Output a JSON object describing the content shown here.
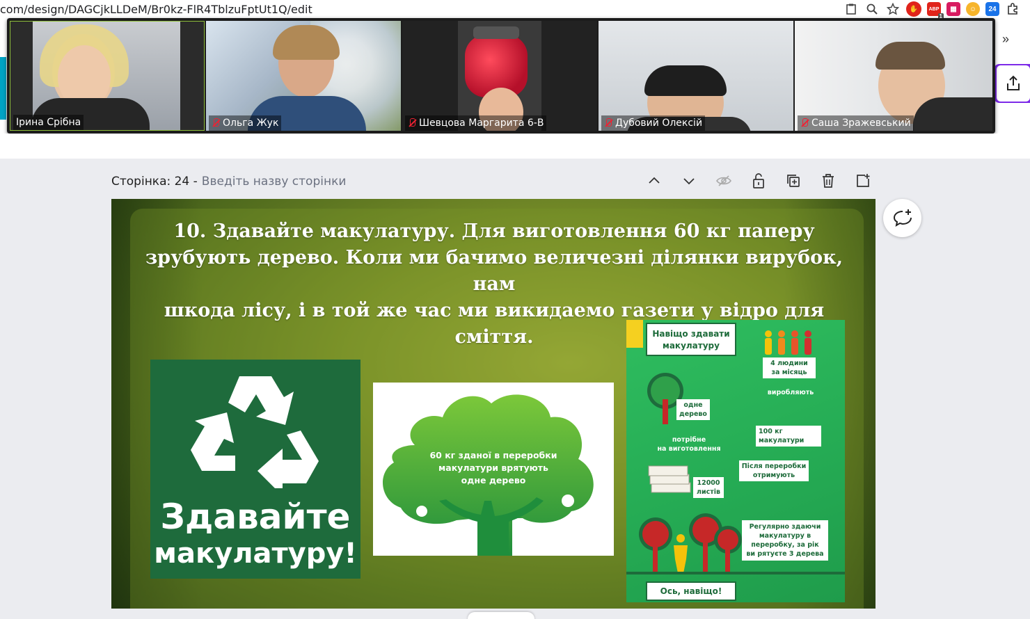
{
  "browser": {
    "url": "com/design/DAGCjkLLDeM/Br0kz-FlR4TblzuFptUt1Q/edit",
    "ext_badge": "1",
    "ext_24": "24",
    "ext_abp": "ABP"
  },
  "zoom": {
    "participants": [
      {
        "name": "Ірина Срібна",
        "muted": false
      },
      {
        "name": "Ольга Жук",
        "muted": true
      },
      {
        "name": "Шевцова Маргарита 6-В",
        "muted": true
      },
      {
        "name": "Дубовий Олексій",
        "muted": true
      },
      {
        "name": "Саша Зражевський",
        "muted": true
      }
    ]
  },
  "page": {
    "label": "Сторінка: 24 -",
    "title_placeholder": "Введіть назву сторінки"
  },
  "slide": {
    "text_line1": "10. Здавайте макулатуру. Для виготовлення 60 кг паперу",
    "text_line2": "зрубують дерево. Коли ми бачимо величезні ділянки вирубок, нам",
    "text_line3": "шкода лісу, і в той же час ми викидаемо газети у відро для сміття.",
    "recycle_line1": "Здавайте",
    "recycle_line2": "макулатуру!",
    "tree_text_line1": "60 кг зданої в переробки",
    "tree_text_line2": "макулатури врятують",
    "tree_text_line3": "одне дерево",
    "info": {
      "title_line1": "Навіщо здавати",
      "title_line2": "макулатуру",
      "people_line1": "4 людини",
      "people_line2": "за місяць",
      "produce": "виробляють",
      "tree_line1": "одне",
      "tree_line2": "дерево",
      "kg_line1": "100 кг",
      "kg_line2": "макулатури",
      "needed_line1": "потрібне",
      "needed_line2": "на виготовлення",
      "after_line1": "Після переробки",
      "after_line2": "отримують",
      "sheets_line1": "12000",
      "sheets_line2": "листів",
      "reg_line1": "Регулярно здаючи",
      "reg_line2": "макулатуру в",
      "reg_line3": "переробку, за рік",
      "reg_line4": "ви рятуєте 3 дерева",
      "bottom": "Ось, навіщо!"
    }
  },
  "colors": {
    "canva_purple": "#7d2ae8",
    "recycle_green": "#1e6b3c",
    "info_green": "#26ad55"
  }
}
